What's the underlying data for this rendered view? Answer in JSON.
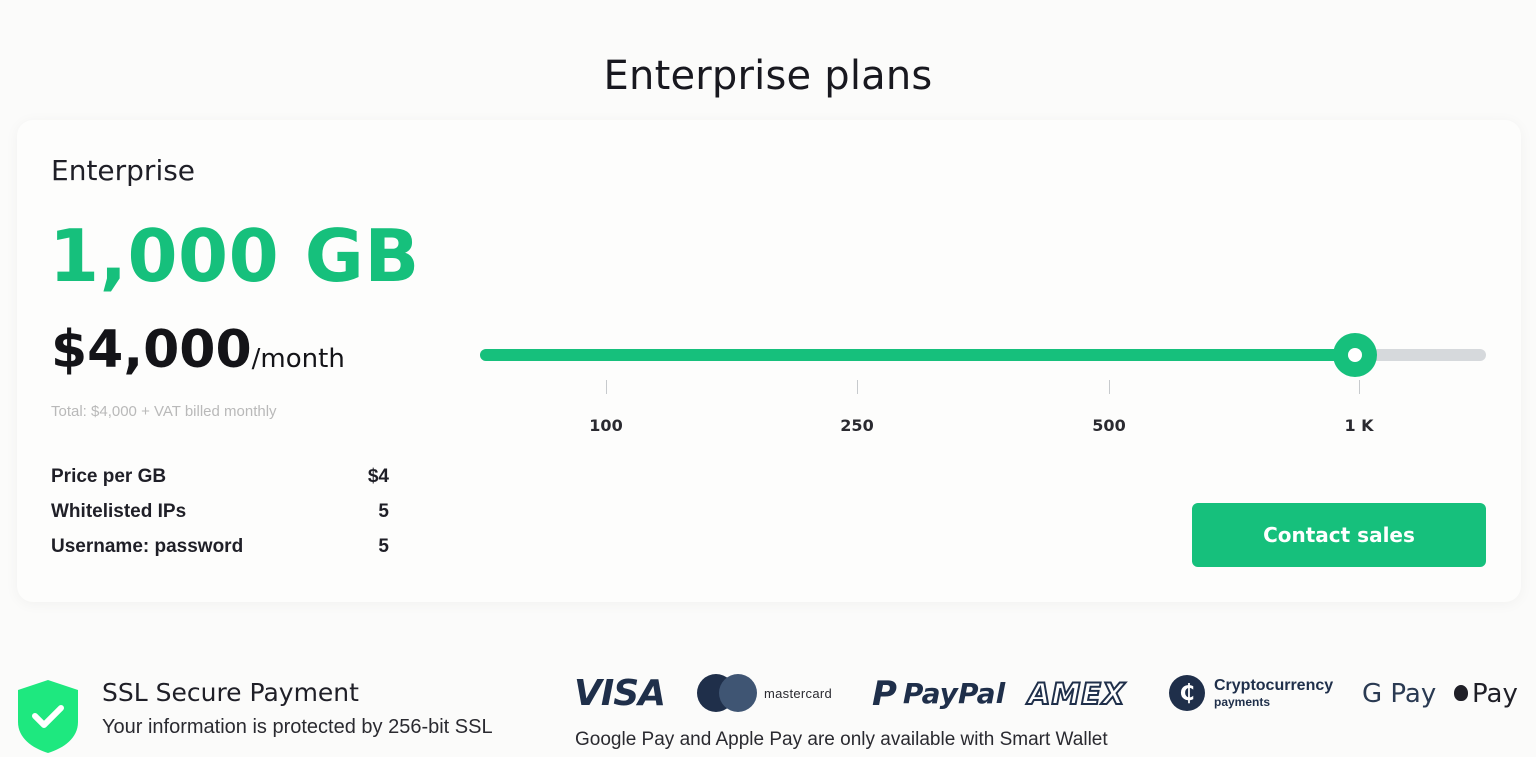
{
  "header": {
    "title": "Enterprise plans"
  },
  "plan": {
    "name": "Enterprise",
    "volume": "1,000 GB",
    "price": "$4,000",
    "price_unit": "/month",
    "total_note": "Total: $4,000 + VAT billed monthly",
    "specs": [
      {
        "label": "Price per GB",
        "value": "$4"
      },
      {
        "label": "Whitelisted IPs",
        "value": "5"
      },
      {
        "label": "Username: password",
        "value": "5"
      }
    ]
  },
  "slider": {
    "value_fraction": 0.87,
    "ticks": [
      "100",
      "250",
      "500",
      "1 K"
    ],
    "selected": "1 K"
  },
  "actions": {
    "contact_label": "Contact sales"
  },
  "security": {
    "title": "SSL Secure Payment",
    "subtitle": "Your information is protected by 256-bit SSL"
  },
  "payments": {
    "visa": "VISA",
    "mastercard": "mastercard",
    "paypal_mark": "P",
    "paypal": "PayPal",
    "amex": "AMEX",
    "crypto_symbol": "₵",
    "crypto_line1": "Cryptocurrency",
    "crypto_line2": "payments",
    "gpay": "G Pay",
    "apay": "Pay",
    "note": "Google Pay and Apple Pay are only available with Smart Wallet"
  },
  "colors": {
    "accent": "#16c07c",
    "brand_dark": "#1f2f4a",
    "track": "#d6d9dc"
  }
}
